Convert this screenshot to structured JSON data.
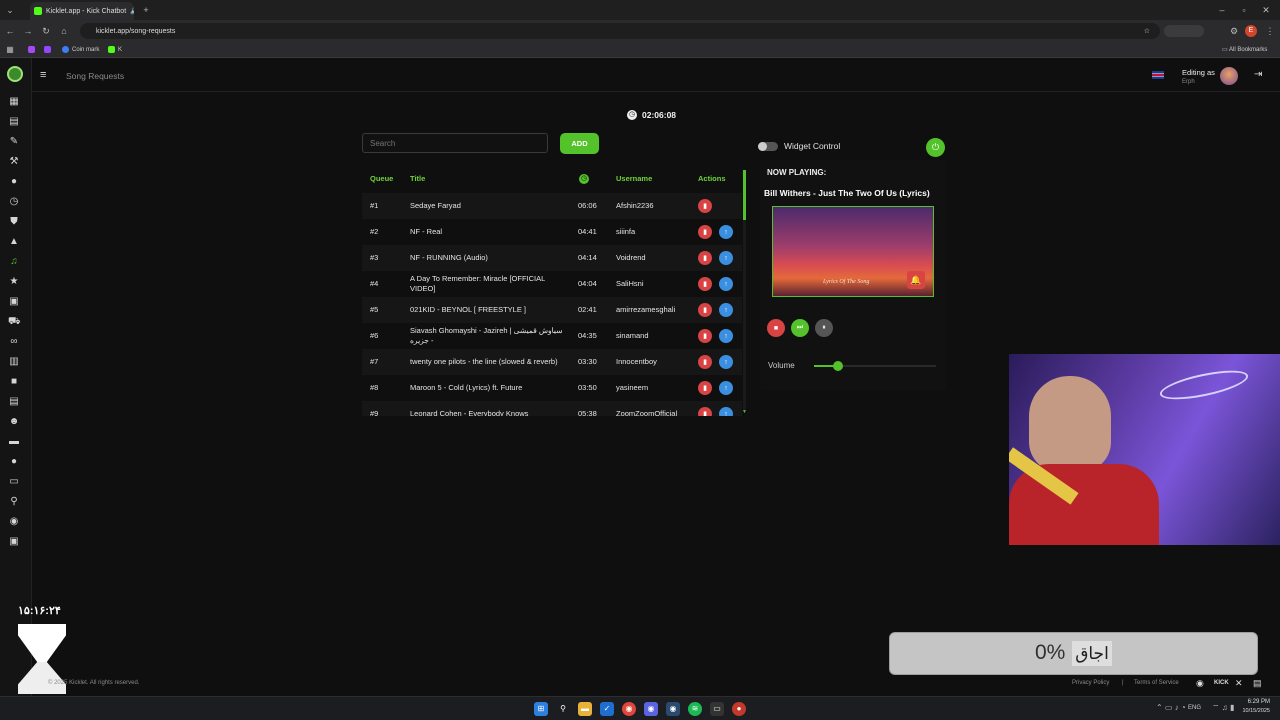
{
  "browser": {
    "tab_title": "Kicklet.app - Kick Chatbot",
    "url": "kicklet.app/song-requests",
    "bookmarks": [
      {
        "label": "Coin mark"
      },
      {
        "label": "K"
      }
    ],
    "all_bookmarks": "All Bookmarks",
    "profile_initial": "E"
  },
  "header": {
    "title": "Song Requests",
    "editing_as": "Editing as",
    "user": "Erph"
  },
  "timer": "02:06:08",
  "search": {
    "placeholder": "Search"
  },
  "add_label": "ADD",
  "table": {
    "columns": {
      "queue": "Queue",
      "title": "Title",
      "username": "Username",
      "actions": "Actions"
    },
    "rows": [
      {
        "queue": "#1",
        "title": "Sedaye Faryad",
        "duration": "06:06",
        "username": "Afshin2236",
        "can_move_up": false
      },
      {
        "queue": "#2",
        "title": "NF - Real",
        "duration": "04:41",
        "username": "siiinfa",
        "can_move_up": true
      },
      {
        "queue": "#3",
        "title": "NF - RUNNING (Audio)",
        "duration": "04:14",
        "username": "Voidrend",
        "can_move_up": true
      },
      {
        "queue": "#4",
        "title": "A Day To Remember: Miracle [OFFICIAL VIDEO]",
        "duration": "04:04",
        "username": "SaliHsni",
        "can_move_up": true
      },
      {
        "queue": "#5",
        "title": "021KID - BEYNOL [ FREESTYLE ]",
        "duration": "02:41",
        "username": "amirrezamesghali",
        "can_move_up": true
      },
      {
        "queue": "#6",
        "title": "Siavash Ghomayshi - Jazireh | سیاوش قمیشی - جزیره",
        "duration": "04:35",
        "username": "sinamand",
        "can_move_up": true
      },
      {
        "queue": "#7",
        "title": "twenty one pilots - the line (slowed & reverb)",
        "duration": "03:30",
        "username": "Innocentboy",
        "can_move_up": true
      },
      {
        "queue": "#8",
        "title": "Maroon 5 - Cold (Lyrics) ft. Future",
        "duration": "03:50",
        "username": "yasineem",
        "can_move_up": true
      },
      {
        "queue": "#9",
        "title": "Leonard Cohen - Everybody Knows",
        "duration": "05:38",
        "username": "ZoomZoomOfficial",
        "can_move_up": true
      }
    ]
  },
  "widget": {
    "control_label": "Widget Control",
    "now_playing_label": "NOW PLAYING:",
    "track": "Bill Withers - Just The Two Of Us (Lyrics)",
    "cover_text": "Lyrics Of The Song",
    "volume_label": "Volume",
    "volume_level": 0.2
  },
  "overlay": {
    "clock": "۱۵:۱۶:۲۴",
    "percent": "0%",
    "label": "اجاق"
  },
  "footer": {
    "copyright": "© 2025 Kicklet. All rights reserved.",
    "privacy": "Privacy Policy",
    "separator": "|",
    "terms": "Terms of Service"
  },
  "taskbar": {
    "lang": "ENG",
    "time": "6:29 PM",
    "date": "10/15/2025"
  },
  "colors": {
    "accent": "#53c22b",
    "delete": "#d84343",
    "move_up": "#3b8fe0"
  }
}
